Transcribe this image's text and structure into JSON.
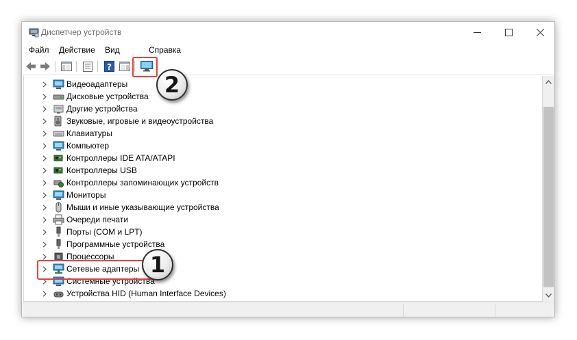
{
  "window": {
    "title": "Диспетчер устройств"
  },
  "menu": [
    "Файл",
    "Действие",
    "Вид",
    "Справка"
  ],
  "toolbar": {
    "buttons": [
      {
        "icon": "back-arrow-icon"
      },
      {
        "icon": "forward-arrow-icon"
      },
      {
        "icon": "show-hide-console-tree-icon"
      },
      {
        "icon": "properties-icon"
      },
      {
        "icon": "help-icon"
      },
      {
        "icon": "action-pane-icon"
      },
      {
        "icon": "scan-hardware-changes-monitor-icon"
      }
    ]
  },
  "tree": {
    "items": [
      {
        "label": "Видеоадаптеры",
        "icon": "display-adapter-icon"
      },
      {
        "label": "Дисковые устройства",
        "icon": "disk-drive-icon"
      },
      {
        "label": "Другие устройства",
        "icon": "other-devices-icon"
      },
      {
        "label": "Звуковые, игровые и видеоустройства",
        "icon": "speaker-icon"
      },
      {
        "label": "Клавиатуры",
        "icon": "keyboard-icon"
      },
      {
        "label": "Компьютер",
        "icon": "computer-icon"
      },
      {
        "label": "Контроллеры IDE ATA/ATAPI",
        "icon": "ide-controller-icon"
      },
      {
        "label": "Контроллеры USB",
        "icon": "usb-controller-icon"
      },
      {
        "label": "Контроллеры запоминающих устройств",
        "icon": "storage-controller-icon"
      },
      {
        "label": "Мониторы",
        "icon": "monitor-icon"
      },
      {
        "label": "Мыши и иные указывающие устройства",
        "icon": "mouse-icon"
      },
      {
        "label": "Очереди печати",
        "icon": "printer-icon"
      },
      {
        "label": "Порты (COM и LPT)",
        "icon": "port-icon"
      },
      {
        "label": "Программные устройства",
        "icon": "software-device-icon"
      },
      {
        "label": "Процессоры",
        "icon": "processor-icon"
      },
      {
        "label": "Сетевые адаптеры",
        "icon": "network-adapter-icon"
      },
      {
        "label": "Системные устройства",
        "icon": "system-devices-icon"
      },
      {
        "label": "Устройства HID (Human Interface Devices)",
        "icon": "hid-device-icon"
      }
    ]
  },
  "annotations": {
    "badge_1": "1",
    "badge_2": "2",
    "color": "#e0433a"
  },
  "colors": {
    "accent_blue": "#1f8fd6",
    "badge_border": "#303030"
  }
}
